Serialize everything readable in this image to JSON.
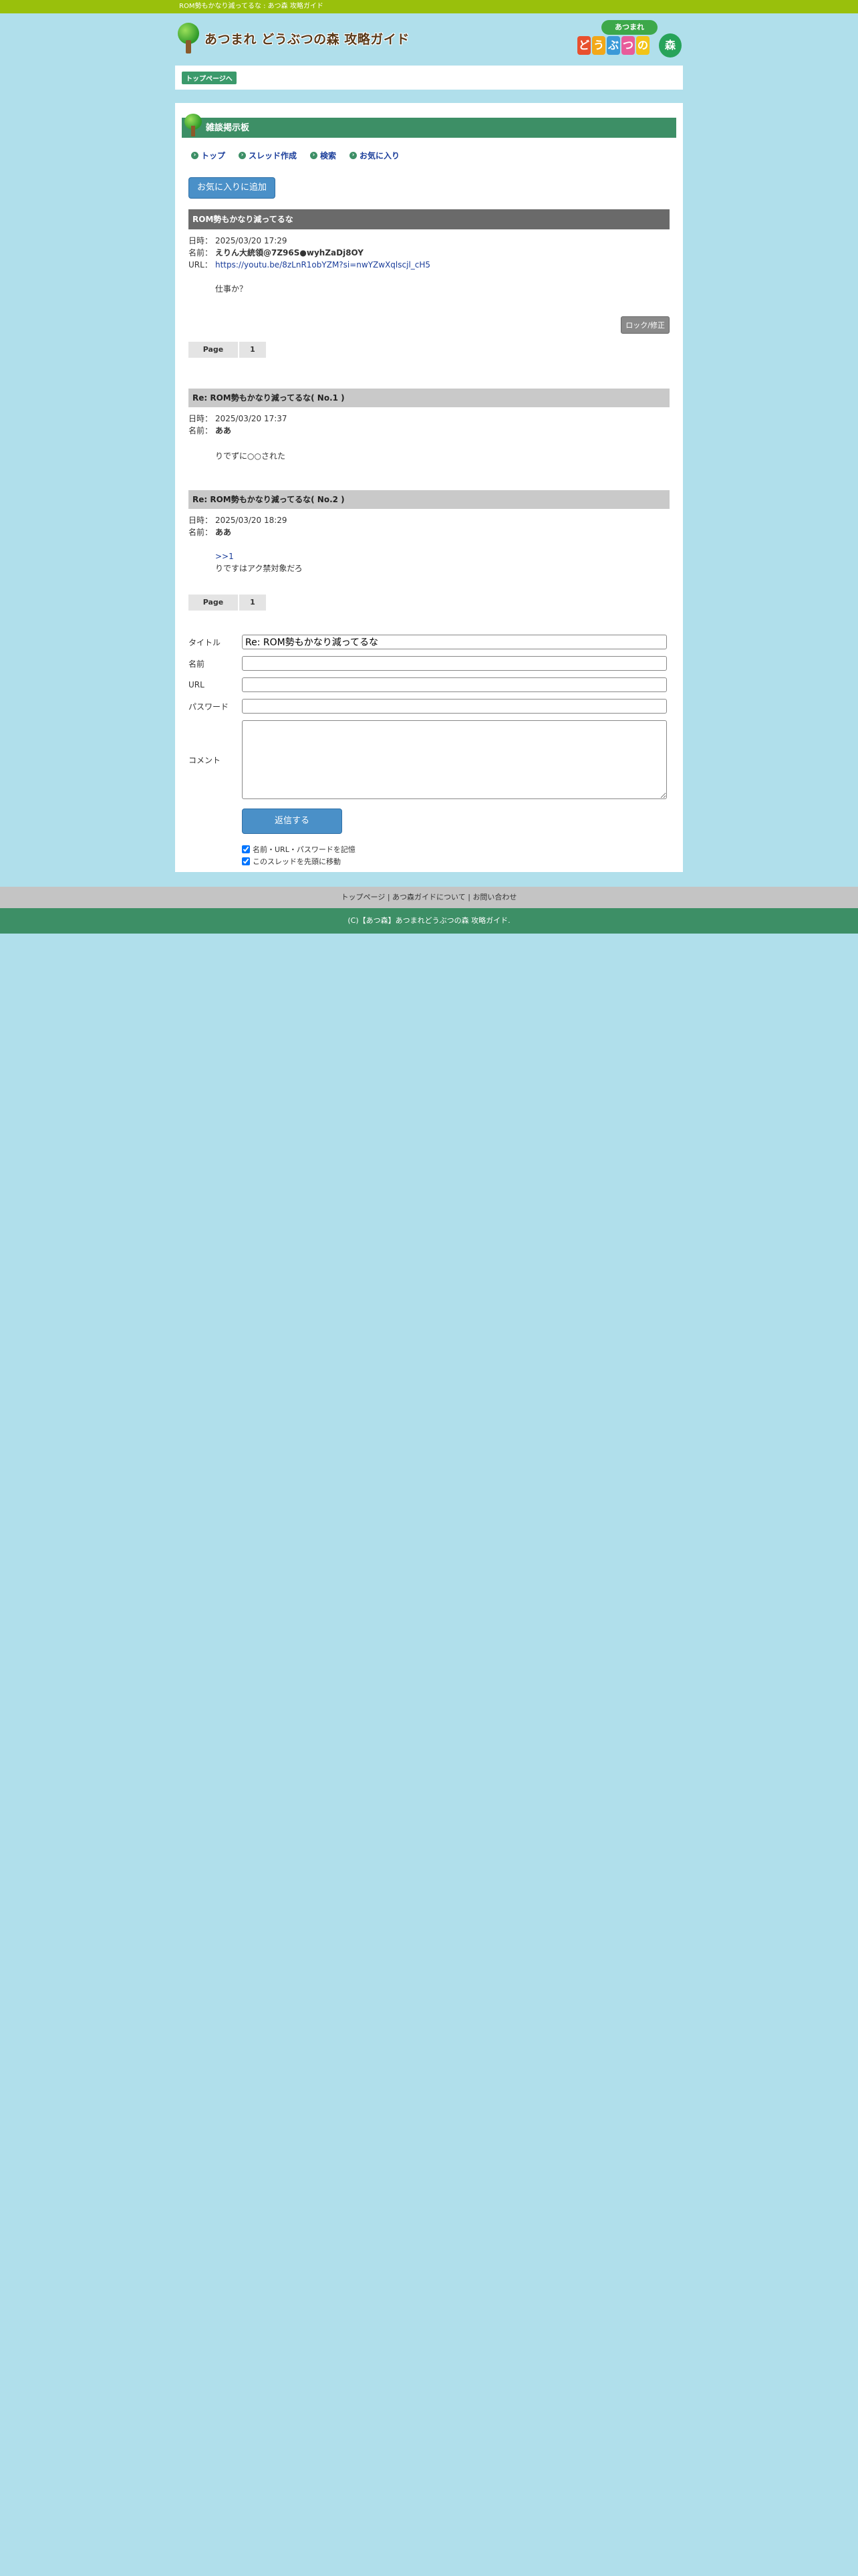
{
  "topbar": {
    "text": "ROM勢もかなり減ってるな : あつ森 攻略ガイド"
  },
  "site": {
    "title": "あつまれ どうぶつの森 攻略ガイド"
  },
  "game_logo": {
    "top": "あつまれ",
    "tiles": [
      "ど",
      "う",
      "ぶ",
      "つ",
      "の"
    ],
    "tile_colors": [
      "#e8502e",
      "#f2a818",
      "#3b9ad8",
      "#e85c9a",
      "#f2c418"
    ],
    "leaf": "森"
  },
  "breadcrumb": {
    "label": "トップページへ"
  },
  "board": {
    "title": "雑談掲示板",
    "nav": [
      {
        "label": "トップ"
      },
      {
        "label": "スレッド作成"
      },
      {
        "label": "検索"
      },
      {
        "label": "お気に入り"
      }
    ],
    "fav_button": "お気に入りに追加"
  },
  "thread": {
    "title": "ROM勢もかなり減ってるな",
    "date_label": "日時：",
    "date": "2025/03/20 17:29",
    "name_label": "名前：",
    "name": "えりん大統領@7Z96S●wyhZaDj8OY",
    "url_label": "URL：",
    "url": "https://youtu.be/8zLnR1obYZM?si=nwYZwXqlscjl_cH5",
    "body": "仕事か？",
    "lock_button": "ロック/修正"
  },
  "pager": {
    "label": "Page",
    "pages": [
      "1"
    ]
  },
  "replies": [
    {
      "title": "Re: ROM勢もかなり減ってるな( No.1 )",
      "date": "2025/03/20 17:37",
      "name": "ああ",
      "body_lines": [
        "りでずに○○された"
      ]
    },
    {
      "title": "Re: ROM勢もかなり減ってるな( No.2 )",
      "date": "2025/03/20 18:29",
      "name": "ああ",
      "link": ">>1",
      "body_lines": [
        "りですはアク禁対象だろ"
      ]
    }
  ],
  "form": {
    "title_label": "タイトル",
    "title_value": "Re: ROM勢もかなり減ってるな",
    "name_label": "名前",
    "url_label": "URL",
    "password_label": "パスワード",
    "comment_label": "コメント",
    "submit": "返信する",
    "remember_label": "名前・URL・パスワードを記憶",
    "move_top_label": "このスレッドを先頭に移動"
  },
  "footer": {
    "links": [
      "トップページ",
      "あつ森ガイドについて",
      "お問い合わせ"
    ],
    "separator": "|",
    "copyright": "(C)【あつ森】あつまれどうぶつの森 攻略ガイド."
  },
  "colors": {
    "topbar": "#99c00c",
    "board_header": "#3d8f66",
    "background": "#b0dfeb",
    "button_blue": "#4a90c8"
  }
}
